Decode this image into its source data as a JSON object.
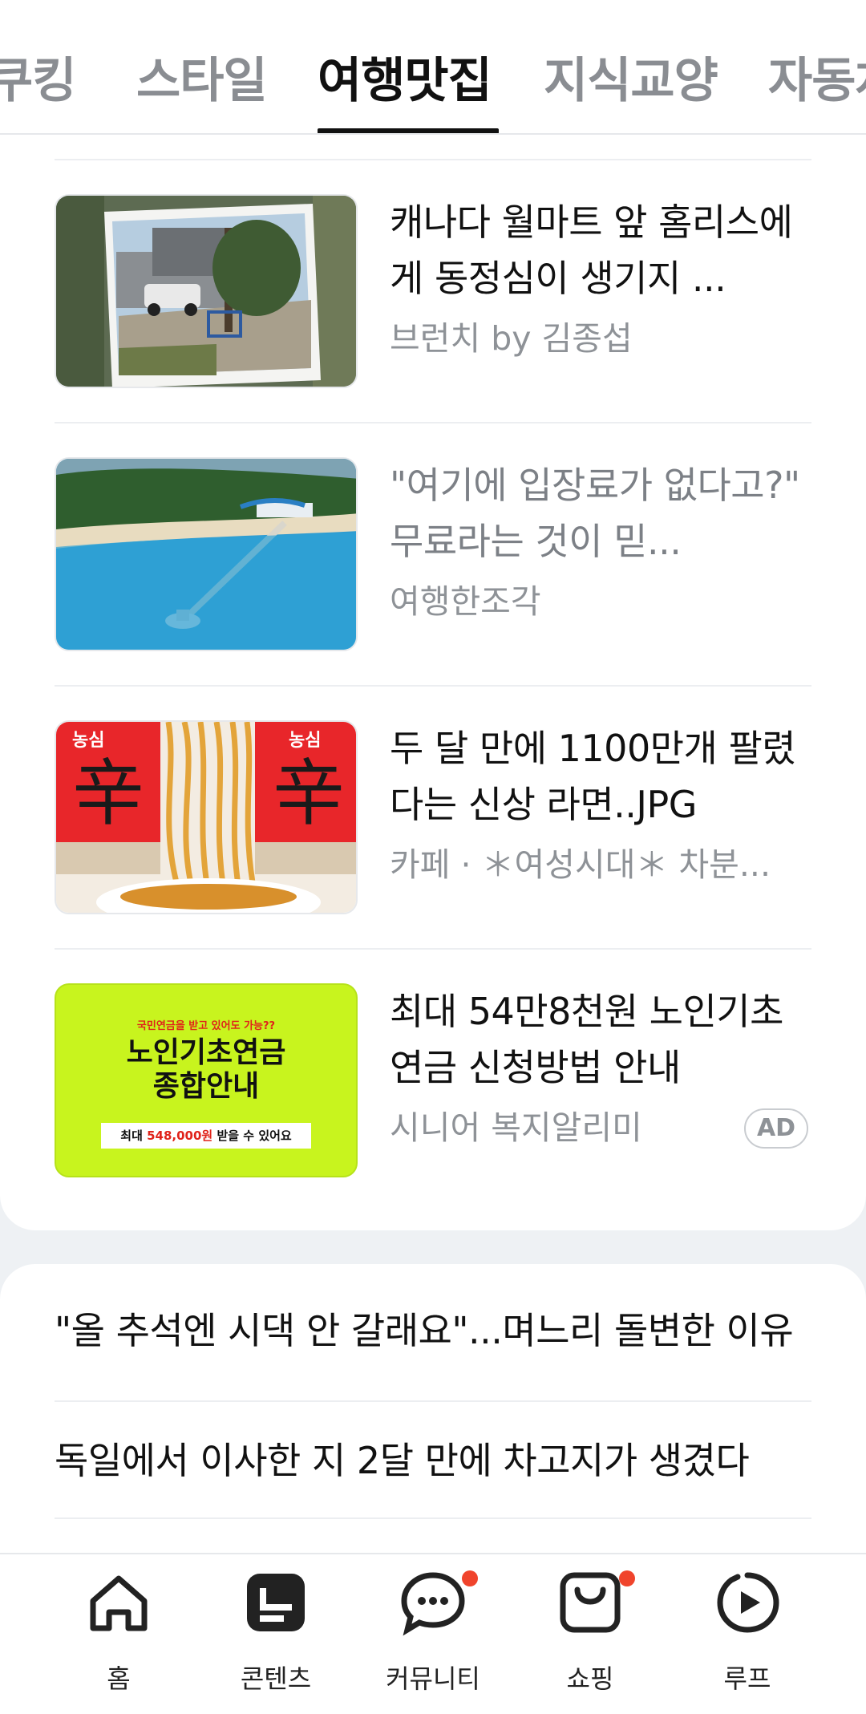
{
  "tabs": [
    {
      "label": "쿠킹",
      "active": false
    },
    {
      "label": "스타일",
      "active": false
    },
    {
      "label": "여행맛집",
      "active": true
    },
    {
      "label": "지식교양",
      "active": false
    },
    {
      "label": "자동차",
      "active": false
    }
  ],
  "feed": [
    {
      "title": "캐나다 월마트 앞 홈리스에게 동정심이 생기지 ...",
      "source": "브런치 by 김종섭",
      "read": false,
      "ad": false,
      "thumb_icon": "parking-lot-photo"
    },
    {
      "title": "\"여기에 입장료가 없다고?\" 무료라는 것이 믿...",
      "source": "여행한조각",
      "read": true,
      "ad": false,
      "thumb_icon": "beach-pier-photo"
    },
    {
      "title": "두 달 만에 1100만개 팔렸다는 신상 라면..JPG",
      "source": "카페 · ＊여성시대＊ 차분...",
      "read": false,
      "ad": false,
      "thumb_icon": "ramen-noodles-photo"
    },
    {
      "title": "최대 54만8천원 노인기초연금 신청방법 안내",
      "source": "시니어 복지알리미",
      "read": false,
      "ad": true,
      "ad_label": "AD",
      "thumb_icon": "pension-ad-banner"
    }
  ],
  "ad_banner": {
    "top_text": "국민연금을 받고 있어도 가능??",
    "headline_line1": "노인기초연금",
    "headline_line2": "종합안내",
    "bottom_prefix": "최대",
    "bottom_amount": "548,000원",
    "bottom_suffix": "받을 수 있어요",
    "bg_color": "#c8f41e",
    "amount_color": "#e0231a"
  },
  "ramen_brand": "농심",
  "ramen_char": "辛",
  "list": [
    "\"올 추석엔 시댁 안 갈래요\"...며느리 돌변한 이유",
    "독일에서 이사한 지 2달 만에 차고지가 생겼다"
  ],
  "bottom_nav": [
    {
      "label": "홈",
      "icon": "home-icon",
      "badge": false
    },
    {
      "label": "콘텐츠",
      "icon": "contents-icon",
      "badge": true
    },
    {
      "label": "커뮤니티",
      "icon": "community-chat-icon",
      "badge": true
    },
    {
      "label": "쇼핑",
      "icon": "shopping-bag-icon",
      "badge": true
    },
    {
      "label": "루프",
      "icon": "loop-play-icon",
      "badge": false
    }
  ],
  "colors": {
    "badge_dot": "#f0442c",
    "text_primary": "#111111",
    "text_secondary": "#8e9297"
  }
}
